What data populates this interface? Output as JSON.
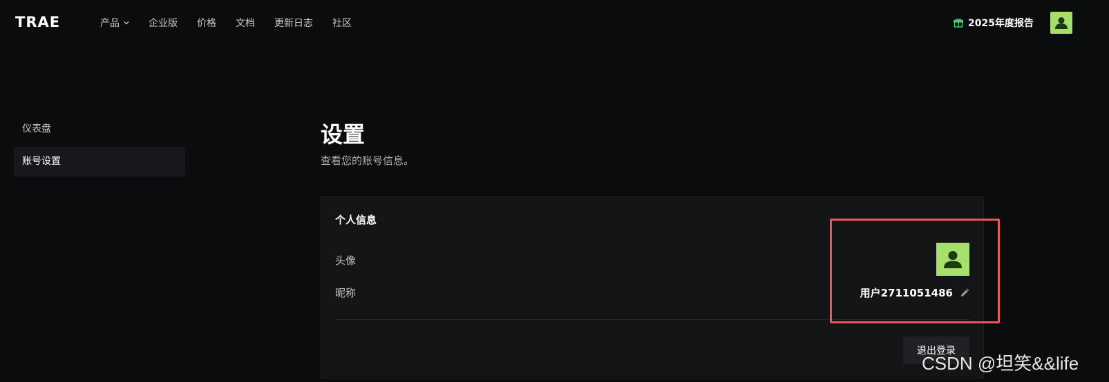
{
  "header": {
    "logo_text": "TRAE",
    "nav": [
      {
        "label": "产品",
        "has_dropdown": true
      },
      {
        "label": "企业版"
      },
      {
        "label": "价格"
      },
      {
        "label": "文档"
      },
      {
        "label": "更新日志"
      },
      {
        "label": "社区"
      }
    ],
    "report_label": "2025年度报告",
    "report_icon": "gift-icon"
  },
  "sidebar": {
    "items": [
      {
        "label": "仪表盘",
        "active": false
      },
      {
        "label": "账号设置",
        "active": true
      }
    ]
  },
  "main": {
    "title": "设置",
    "subtitle": "查看您的账号信息。",
    "card": {
      "title": "个人信息",
      "avatar_label": "头像",
      "nickname_label": "昵称",
      "nickname_value": "用户2711051486",
      "logout_label": "退出登录"
    }
  },
  "watermark": "CSDN @坦笑&&life",
  "colors": {
    "background": "#0b0c0e",
    "avatar_bg": "#a6e06a",
    "accent_green": "#4ed17a",
    "annotation": "#e85a55"
  }
}
